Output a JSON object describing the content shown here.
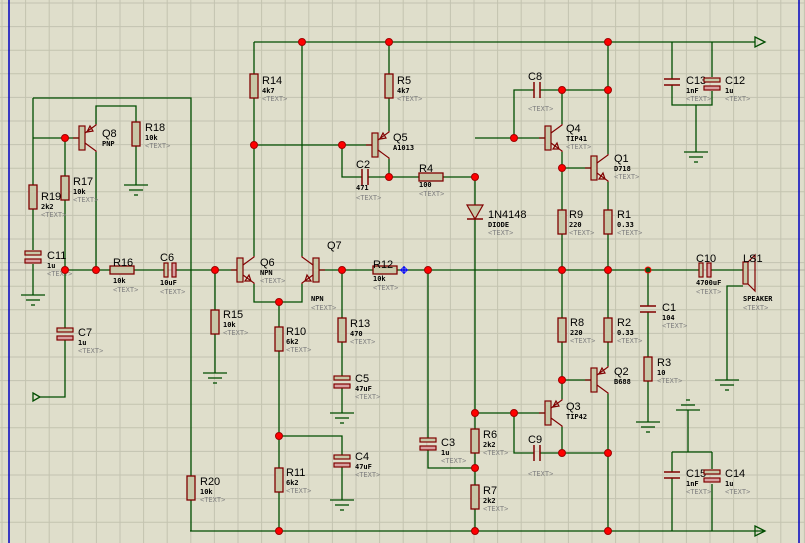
{
  "schematic": {
    "colors": {
      "background": "#dfdecb",
      "grid": "#c3c3b0",
      "wire": "#004d00",
      "component": "#800000",
      "body": "#c8c8a8",
      "junction": "#ff0000",
      "border": "#0000c0",
      "probe": "#0000ff"
    },
    "components": [
      {
        "ref": "R14",
        "value": "4k7",
        "text": "<TEXT>"
      },
      {
        "ref": "R5",
        "value": "4k7",
        "text": "<TEXT>"
      },
      {
        "ref": "Q5",
        "value": "A1013",
        "text": ""
      },
      {
        "ref": "C2",
        "value": "471",
        "text": "<TEXT>"
      },
      {
        "ref": "R4",
        "value": "100",
        "text": "<TEXT>"
      },
      {
        "ref": "Q6",
        "value": "NPN",
        "text": "<TEXT>"
      },
      {
        "ref": "Q7",
        "value": "NPN",
        "text": "<TEXT>"
      },
      {
        "ref": "R12",
        "value": "10k",
        "text": "<TEXT>"
      },
      {
        "ref": "1N4148",
        "value": "DIODE",
        "text": "<TEXT>"
      },
      {
        "ref": "C8",
        "value": "",
        "text": "<TEXT>"
      },
      {
        "ref": "Q4",
        "value": "TIP41",
        "text": "<TEXT>"
      },
      {
        "ref": "Q1",
        "value": "D718",
        "text": "<TEXT>"
      },
      {
        "ref": "R9",
        "value": "220",
        "text": "<TEXT>"
      },
      {
        "ref": "R1",
        "value": "0.33",
        "text": "<TEXT>"
      },
      {
        "ref": "C13",
        "value": "1nF",
        "text": "<TEXT>"
      },
      {
        "ref": "C12",
        "value": "1u",
        "text": "<TEXT>"
      },
      {
        "ref": "C10",
        "value": "4700uF",
        "text": "<TEXT>"
      },
      {
        "ref": "LS1",
        "value": "SPEAKER",
        "text": "<TEXT>"
      },
      {
        "ref": "Q8",
        "value": "PNP",
        "text": ""
      },
      {
        "ref": "R18",
        "value": "10k",
        "text": "<TEXT>"
      },
      {
        "ref": "R17",
        "value": "10k",
        "text": "<TEXT>"
      },
      {
        "ref": "R19",
        "value": "2k2",
        "text": "<TEXT>"
      },
      {
        "ref": "C11",
        "value": "1u",
        "text": "<TEXT>"
      },
      {
        "ref": "R16",
        "value": "10k",
        "text": "<TEXT>"
      },
      {
        "ref": "C6",
        "value": "10uF",
        "text": "<TEXT>"
      },
      {
        "ref": "C7",
        "value": "1u",
        "text": "<TEXT>"
      },
      {
        "ref": "R15",
        "value": "10k",
        "text": "<TEXT>"
      },
      {
        "ref": "R10",
        "value": "6k2",
        "text": "<TEXT>"
      },
      {
        "ref": "R13",
        "value": "470",
        "text": "<TEXT>"
      },
      {
        "ref": "C5",
        "value": "47uF",
        "text": "<TEXT>"
      },
      {
        "ref": "C4",
        "value": "47uF",
        "text": "<TEXT>"
      },
      {
        "ref": "R11",
        "value": "6k2",
        "text": "<TEXT>"
      },
      {
        "ref": "R20",
        "value": "10k",
        "text": "<TEXT>"
      },
      {
        "ref": "C3",
        "value": "1u",
        "text": "<TEXT>"
      },
      {
        "ref": "R6",
        "value": "2k2",
        "text": "<TEXT>"
      },
      {
        "ref": "R7",
        "value": "2k2",
        "text": "<TEXT>"
      },
      {
        "ref": "R8",
        "value": "220",
        "text": "<TEXT>"
      },
      {
        "ref": "R2",
        "value": "0.33",
        "text": "<TEXT>"
      },
      {
        "ref": "C1",
        "value": "104",
        "text": "<TEXT>"
      },
      {
        "ref": "R3",
        "value": "10",
        "text": "<TEXT>"
      },
      {
        "ref": "Q2",
        "value": "B688",
        "text": ""
      },
      {
        "ref": "Q3",
        "value": "TIP42",
        "text": ""
      },
      {
        "ref": "C9",
        "value": "",
        "text": "<TEXT>"
      },
      {
        "ref": "C15",
        "value": "1nF",
        "text": "<TEXT>"
      },
      {
        "ref": "C14",
        "value": "1u",
        "text": "<TEXT>"
      }
    ]
  }
}
